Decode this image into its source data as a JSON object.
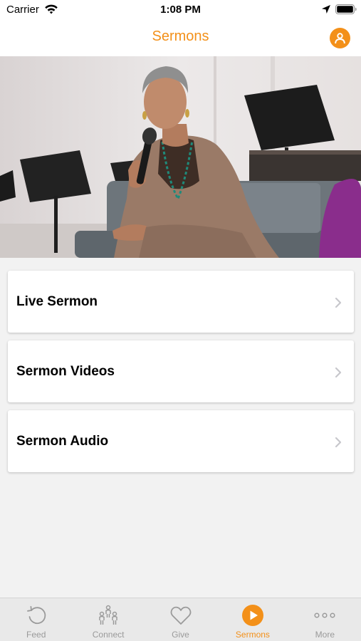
{
  "status_bar": {
    "carrier": "Carrier",
    "time": "1:08 PM",
    "icons": [
      "wifi-icon",
      "location-icon",
      "battery-icon"
    ]
  },
  "nav": {
    "title": "Sermons",
    "profile_icon": "person-icon",
    "accent_color": "#f39019"
  },
  "hero": {
    "description_icon": "hero-photo"
  },
  "menu": {
    "items": [
      {
        "label": "Live Sermon",
        "icon": "chevron-right-icon"
      },
      {
        "label": "Sermon Videos",
        "icon": "chevron-right-icon"
      },
      {
        "label": "Sermon Audio",
        "icon": "chevron-right-icon"
      }
    ]
  },
  "tab_bar": {
    "tabs": [
      {
        "label": "Feed",
        "icon": "refresh-icon"
      },
      {
        "label": "Connect",
        "icon": "people-icon"
      },
      {
        "label": "Give",
        "icon": "heart-icon"
      },
      {
        "label": "Sermons",
        "icon": "play-icon",
        "active": true
      },
      {
        "label": "More",
        "icon": "more-icon"
      }
    ],
    "inactive_color": "#9a9a9a",
    "active_color": "#f39019"
  }
}
